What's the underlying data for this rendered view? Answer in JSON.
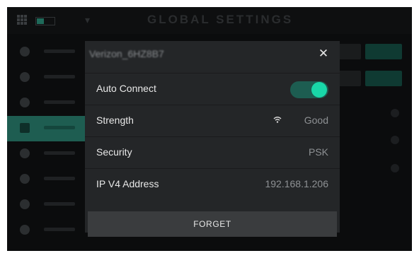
{
  "app": {
    "title": "GLOBAL SETTINGS",
    "accent": "#19d7a8",
    "accent_dark": "#1d5d51"
  },
  "sidebar": {
    "items": [
      {
        "icon": "gear-icon"
      },
      {
        "icon": "link-icon"
      },
      {
        "icon": "bluetooth-icon"
      },
      {
        "icon": "wifi-icon",
        "active": true
      },
      {
        "icon": "hand-icon"
      },
      {
        "icon": "midi-icon"
      },
      {
        "icon": "pedal-icon"
      },
      {
        "icon": "info-icon"
      }
    ]
  },
  "modal": {
    "network_name": "Verizon_6HZ8B7",
    "close_icon": "close-icon",
    "rows": [
      {
        "label": "Auto Connect",
        "toggle_on": true
      },
      {
        "label": "Strength",
        "icon": "wifi-signal-icon",
        "value": "Good"
      },
      {
        "label": "Security",
        "value": "PSK"
      },
      {
        "label": "IP V4 Address",
        "value": "192.168.1.206"
      }
    ],
    "forget_label": "FORGET"
  }
}
